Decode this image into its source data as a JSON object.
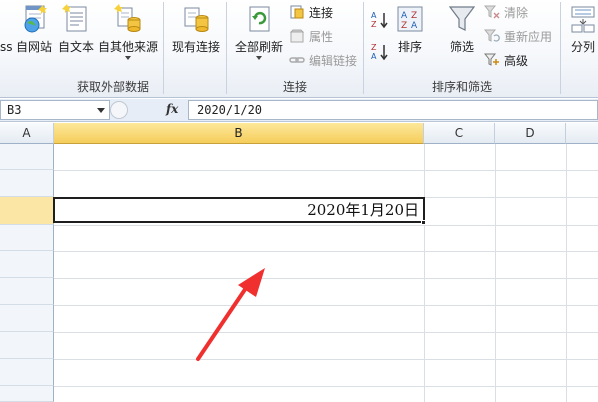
{
  "ribbon": {
    "get_external_data": {
      "access_partial": "ss",
      "from_web": "自网站",
      "from_text": "自文本",
      "from_other": "自其他来源",
      "existing_connections": "现有连接",
      "group_label": "获取外部数据"
    },
    "connections": {
      "refresh_all": "全部刷新",
      "connections": "连接",
      "properties": "属性",
      "edit_links": "编辑链接",
      "group_label": "连接"
    },
    "sort_filter": {
      "sort": "排序",
      "filter": "筛选",
      "clear": "清除",
      "reapply": "重新应用",
      "advanced": "高级",
      "group_label": "排序和筛选"
    },
    "data_tools": {
      "text_to_columns_partial": "分列"
    }
  },
  "formula_bar": {
    "name_box": "B3",
    "fx": "fx",
    "formula": "2020/1/20"
  },
  "grid": {
    "columns": [
      "A",
      "B",
      "C",
      "D"
    ],
    "selected_column": "B",
    "cell_b3_value": "2020年1月20日"
  },
  "colors": {
    "selection_header": "#f6cd5c",
    "arrow": "#f0302f",
    "cell_border": "#1e1e1e"
  }
}
